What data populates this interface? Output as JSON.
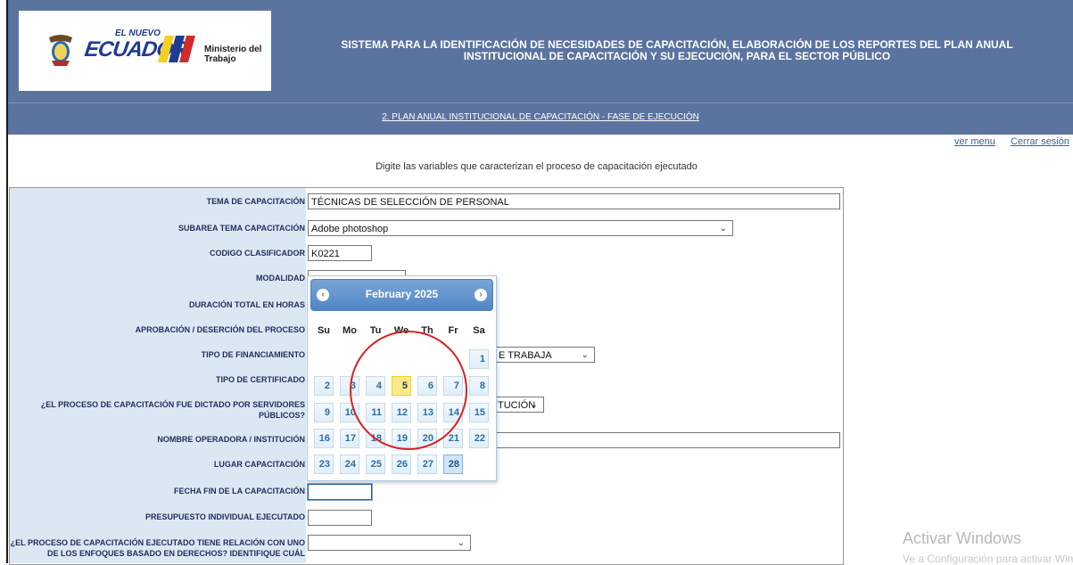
{
  "header": {
    "logo_tagline": "EL NUEVO",
    "logo_text": "ECUADOR",
    "ministry": "Ministerio del Trabajo",
    "system_title": "SISTEMA PARA LA IDENTIFICACIÓN DE NECESIDADES DE CAPACITACIÓN, ELABORACIÓN DE LOS REPORTES DEL PLAN ANUAL INSTITUCIONAL DE CAPACITACIÓN Y SU EJECUCIÓN, PARA EL SECTOR PÚBLICO",
    "phase_link": "2. PLAN ANUAL INSTITUCIONAL DE CAPACITACIÓN - FASE DE EJECUCIÓN"
  },
  "links": {
    "ver_menu": "ver menu",
    "cerrar_sesion": "Cerrar sesión"
  },
  "instructions": "Digite las variables que caracterizan el proceso de capacitación ejecutado",
  "form": {
    "tema_label": "TEMA DE CAPACITACIÓN",
    "tema_value": "TÉCNICAS DE SELECCIÓN DE PERSONAL",
    "subarea_label": "SUBAREA TEMA CAPACITACIÓN",
    "subarea_value": "Adobe photoshop",
    "codigo_label": "CODIGO CLASIFICADOR",
    "codigo_value": "K0221",
    "modalidad_label": "MODALIDAD",
    "duracion_label": "DURACIÓN TOTAL EN HORAS",
    "aprobacion_label": "APROBACIÓN / DESERCIÓN DEL PROCESO",
    "financiamiento_label": "TIPO DE FINANCIAMIENTO",
    "financiamiento_value": "E TRABAJA",
    "certificado_label": "TIPO DE CERTIFICADO",
    "servidores_label_1": "¿EL PROCESO DE CAPACITACIÓN FUE DICTADO POR SERVIDORES",
    "servidores_label_2": "PÚBLICOS?",
    "servidores_value": "TUCIÓN",
    "operadora_label": "NOMBRE OPERADORA / INSTITUCIÓN",
    "lugar_label": "LUGAR CAPACITACIÓN",
    "fecha_fin_label": "FECHA FIN DE LA CAPACITACIÓN",
    "presupuesto_label": "PRESUPUESTO INDIVIDUAL EJECUTADO",
    "enfoques_label_1": "¿EL PROCESO DE CAPACITACIÓN EJECUTADO TIENE RELACIÓN CON UNO",
    "enfoques_label_2": "DE LOS ENFOQUES BASADO EN DERECHOS? IDENTIFIQUE CUÁL"
  },
  "datepicker": {
    "month_title": "February 2025",
    "prev_label": "‹",
    "next_label": "›",
    "weekdays": [
      "Su",
      "Mo",
      "Tu",
      "We",
      "Th",
      "Fr",
      "Sa"
    ],
    "weeks": [
      [
        "",
        "",
        "",
        "",
        "",
        "",
        "1"
      ],
      [
        "2",
        "3",
        "4",
        "5",
        "6",
        "7",
        "8"
      ],
      [
        "9",
        "10",
        "11",
        "12",
        "13",
        "14",
        "15"
      ],
      [
        "16",
        "17",
        "18",
        "19",
        "20",
        "21",
        "22"
      ],
      [
        "23",
        "24",
        "25",
        "26",
        "27",
        "28",
        ""
      ]
    ],
    "today": "5",
    "selected": "28"
  },
  "watermark": {
    "title": "Activar Windows",
    "subtitle": "Ve a Configuración para activar Windows."
  },
  "colors": {
    "header_bg": "#5b739f",
    "label_bg": "#dce7f4",
    "label_text": "#1e2e5c",
    "annotation": "#d92121"
  }
}
